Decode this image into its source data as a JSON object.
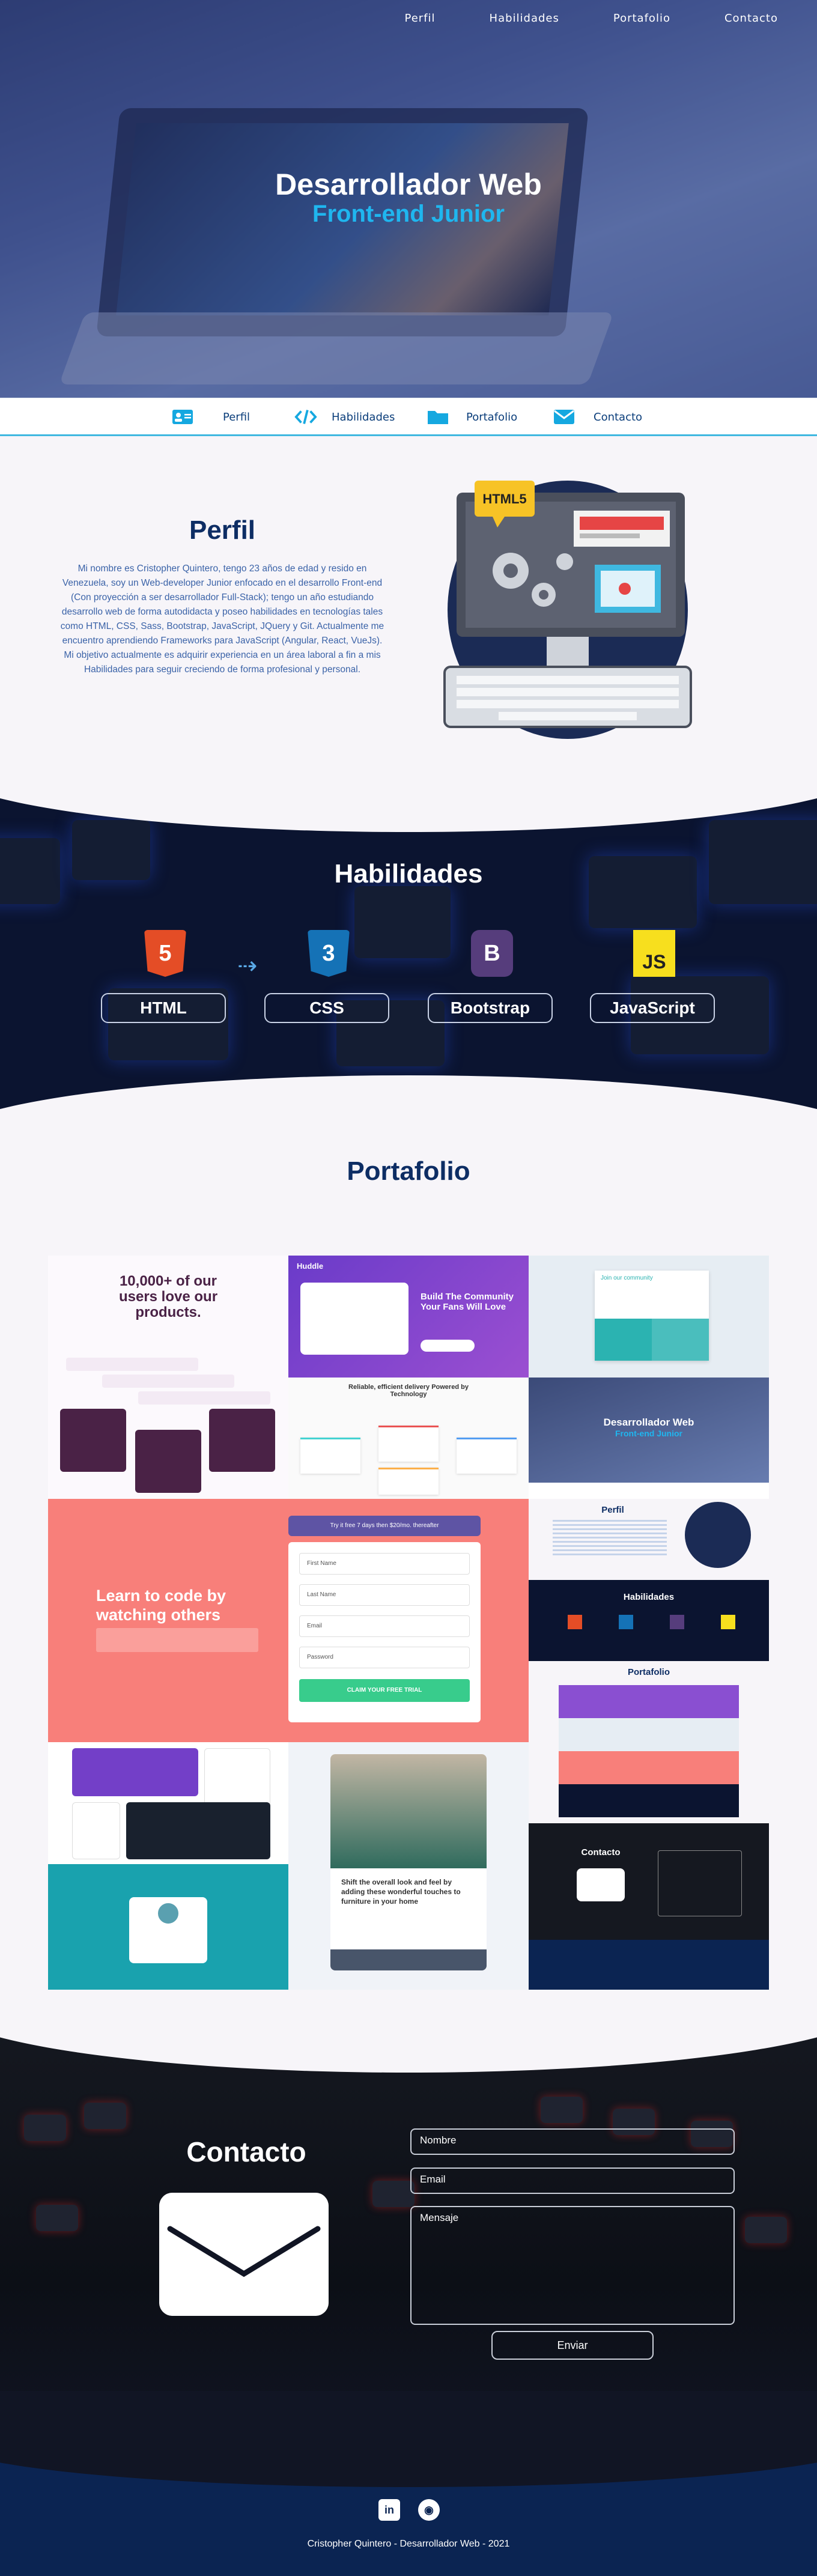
{
  "nav": [
    "Perfil",
    "Habilidades",
    "Portafolio",
    "Contacto"
  ],
  "hero": {
    "title": "Desarrollador Web",
    "subtitle": "Front-end Junior"
  },
  "subnav": [
    {
      "label": "Perfil",
      "icon": "id-card-icon"
    },
    {
      "label": "Habilidades",
      "icon": "code-icon"
    },
    {
      "label": "Portafolio",
      "icon": "folder-icon"
    },
    {
      "label": "Contacto",
      "icon": "envelope-icon"
    }
  ],
  "perfil": {
    "title": "Perfil",
    "text": "Mi nombre es Cristopher Quintero, tengo 23 años de edad y resido en Venezuela, soy un Web-developer Junior enfocado en el desarrollo Front-end (Con proyección a ser desarrollador Full-Stack); tengo un año estudiando desarrollo web de forma autodidacta y poseo habilidades en tecnologías tales como HTML, CSS, Sass, Bootstrap, JavaScript, JQuery y Git. Actualmente me encuentro aprendiendo Frameworks para JavaScript (Angular, React, VueJs). Mi objetivo actualmente es adquirir experiencia en un área laboral a fin a mis Habilidades para seguir creciendo de forma profesional y personal.",
    "illustration_label": "HTML5"
  },
  "habilidades": {
    "title": "Habilidades",
    "items": [
      {
        "name": "HTML",
        "logo": "5",
        "color": "#e44d26"
      },
      {
        "name": "CSS",
        "logo": "3",
        "color": "#1572b6"
      },
      {
        "name": "Bootstrap",
        "logo": "B",
        "color": "#563d7c"
      },
      {
        "name": "JavaScript",
        "logo": "JS",
        "color": "#f7df1e"
      }
    ]
  },
  "portafolio": {
    "title": "Portafolio",
    "tiles": {
      "t1": {
        "heading": "10,000+ of our users love our products."
      },
      "t2": {
        "brand": "Huddle",
        "heading": "Build The Community Your Fans Will Love"
      },
      "t3": {
        "heading": "Join our community"
      },
      "t4": {
        "heading": "Reliable, efficient delivery Powered by Technology"
      },
      "t5": {
        "title": "Desarrollador Web",
        "subtitle": "Front-end Junior"
      },
      "t6": {
        "heading": "Learn to code by watching others",
        "cta": "Try it free 7 days then $20/mo. thereafter",
        "fields": [
          "First Name",
          "Last Name",
          "Email",
          "Password"
        ],
        "button": "CLAIM YOUR FREE TRIAL"
      },
      "t7": {
        "heading": "Perfil"
      },
      "t8": {
        "heading": "Habilidades"
      },
      "t9": {
        "heading": "Portafolio"
      },
      "t11": {
        "heading": "Shift the overall look and feel by adding these wonderful touches to furniture in your home"
      },
      "t12": {
        "heading": "Contacto"
      }
    }
  },
  "contacto": {
    "title": "Contacto",
    "nombre_placeholder": "Nombre",
    "email_placeholder": "Email",
    "mensaje_placeholder": "Mensaje",
    "send": "Enviar"
  },
  "footer": {
    "social": [
      {
        "label": "in",
        "icon": "linkedin-icon"
      },
      {
        "label": "◉",
        "icon": "github-icon"
      }
    ],
    "copyright": "Cristopher Quintero - Desarrollador Web - 2021"
  }
}
